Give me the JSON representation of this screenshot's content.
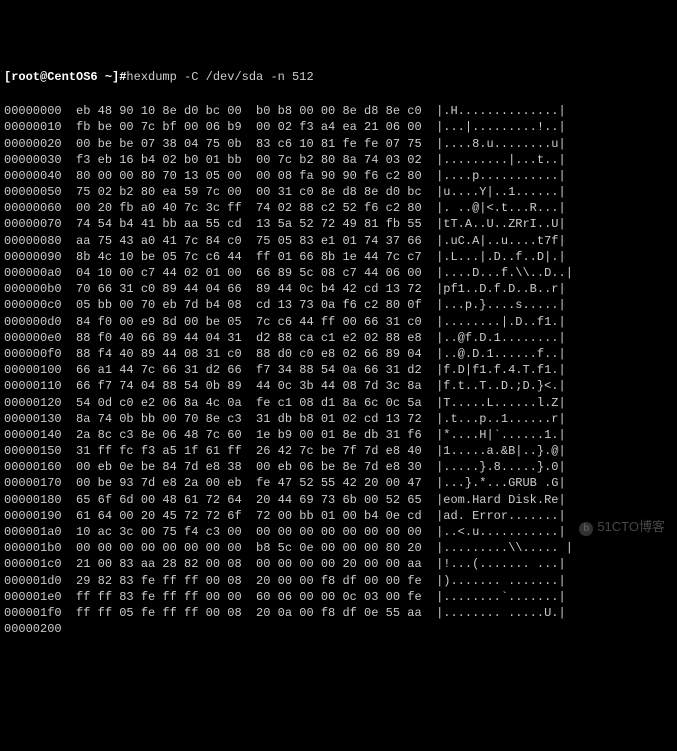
{
  "prompt": {
    "prefix": "[root@CentOS6 ~]#",
    "command": "hexdump -C /dev/sda -n 512"
  },
  "watermark": "51CTO博客",
  "lines": [
    {
      "offset": "00000000",
      "h1": "eb 48 90 10 8e d0 bc 00",
      "h2": "b0 b8 00 00 8e d8 8e c0",
      "ascii": "|.H..............|"
    },
    {
      "offset": "00000010",
      "h1": "fb be 00 7c bf 00 06 b9",
      "h2": "00 02 f3 a4 ea 21 06 00",
      "ascii": "|...|.........!..|"
    },
    {
      "offset": "00000020",
      "h1": "00 be be 07 38 04 75 0b",
      "h2": "83 c6 10 81 fe fe 07 75",
      "ascii": "|....8.u........u|"
    },
    {
      "offset": "00000030",
      "h1": "f3 eb 16 b4 02 b0 01 bb",
      "h2": "00 7c b2 80 8a 74 03 02",
      "ascii": "|.........|...t..|"
    },
    {
      "offset": "00000040",
      "h1": "80 00 00 80 70 13 05 00",
      "h2": "00 08 fa 90 90 f6 c2 80",
      "ascii": "|....p...........|"
    },
    {
      "offset": "00000050",
      "h1": "75 02 b2 80 ea 59 7c 00",
      "h2": "00 31 c0 8e d8 8e d0 bc",
      "ascii": "|u....Y|..1......|"
    },
    {
      "offset": "00000060",
      "h1": "00 20 fb a0 40 7c 3c ff",
      "h2": "74 02 88 c2 52 f6 c2 80",
      "ascii": "|. ..@|<.t...R...|"
    },
    {
      "offset": "00000070",
      "h1": "74 54 b4 41 bb aa 55 cd",
      "h2": "13 5a 52 72 49 81 fb 55",
      "ascii": "|tT.A..U..ZRrI..U|"
    },
    {
      "offset": "00000080",
      "h1": "aa 75 43 a0 41 7c 84 c0",
      "h2": "75 05 83 e1 01 74 37 66",
      "ascii": "|.uC.A|..u....t7f|"
    },
    {
      "offset": "00000090",
      "h1": "8b 4c 10 be 05 7c c6 44",
      "h2": "ff 01 66 8b 1e 44 7c c7",
      "ascii": "|.L...|.D..f..D|.|"
    },
    {
      "offset": "000000a0",
      "h1": "04 10 00 c7 44 02 01 00",
      "h2": "66 89 5c 08 c7 44 06 00",
      "ascii": "|....D...f.\\\\..D..|"
    },
    {
      "offset": "000000b0",
      "h1": "70 66 31 c0 89 44 04 66",
      "h2": "89 44 0c b4 42 cd 13 72",
      "ascii": "|pf1..D.f.D..B..r|"
    },
    {
      "offset": "000000c0",
      "h1": "05 bb 00 70 eb 7d b4 08",
      "h2": "cd 13 73 0a f6 c2 80 0f",
      "ascii": "|...p.}....s.....|"
    },
    {
      "offset": "000000d0",
      "h1": "84 f0 00 e9 8d 00 be 05",
      "h2": "7c c6 44 ff 00 66 31 c0",
      "ascii": "|........|.D..f1.|"
    },
    {
      "offset": "000000e0",
      "h1": "88 f0 40 66 89 44 04 31",
      "h2": "d2 88 ca c1 e2 02 88 e8",
      "ascii": "|..@f.D.1........|"
    },
    {
      "offset": "000000f0",
      "h1": "88 f4 40 89 44 08 31 c0",
      "h2": "88 d0 c0 e8 02 66 89 04",
      "ascii": "|..@.D.1......f..|"
    },
    {
      "offset": "00000100",
      "h1": "66 a1 44 7c 66 31 d2 66",
      "h2": "f7 34 88 54 0a 66 31 d2",
      "ascii": "|f.D|f1.f.4.T.f1.|"
    },
    {
      "offset": "00000110",
      "h1": "66 f7 74 04 88 54 0b 89",
      "h2": "44 0c 3b 44 08 7d 3c 8a",
      "ascii": "|f.t..T..D.;D.}<.|"
    },
    {
      "offset": "00000120",
      "h1": "54 0d c0 e2 06 8a 4c 0a",
      "h2": "fe c1 08 d1 8a 6c 0c 5a",
      "ascii": "|T.....L......l.Z|"
    },
    {
      "offset": "00000130",
      "h1": "8a 74 0b bb 00 70 8e c3",
      "h2": "31 db b8 01 02 cd 13 72",
      "ascii": "|.t...p..1......r|"
    },
    {
      "offset": "00000140",
      "h1": "2a 8c c3 8e 06 48 7c 60",
      "h2": "1e b9 00 01 8e db 31 f6",
      "ascii": "|*....H|`......1.|"
    },
    {
      "offset": "00000150",
      "h1": "31 ff fc f3 a5 1f 61 ff",
      "h2": "26 42 7c be 7f 7d e8 40",
      "ascii": "|1.....a.&B|..}.@|"
    },
    {
      "offset": "00000160",
      "h1": "00 eb 0e be 84 7d e8 38",
      "h2": "00 eb 06 be 8e 7d e8 30",
      "ascii": "|.....}.8.....}.0|"
    },
    {
      "offset": "00000170",
      "h1": "00 be 93 7d e8 2a 00 eb",
      "h2": "fe 47 52 55 42 20 00 47",
      "ascii": "|...}.*...GRUB .G|"
    },
    {
      "offset": "00000180",
      "h1": "65 6f 6d 00 48 61 72 64",
      "h2": "20 44 69 73 6b 00 52 65",
      "ascii": "|eom.Hard Disk.Re|"
    },
    {
      "offset": "00000190",
      "h1": "61 64 00 20 45 72 72 6f",
      "h2": "72 00 bb 01 00 b4 0e cd",
      "ascii": "|ad. Error.......|"
    },
    {
      "offset": "000001a0",
      "h1": "10 ac 3c 00 75 f4 c3 00",
      "h2": "00 00 00 00 00 00 00 00",
      "ascii": "|..<.u...........|"
    },
    {
      "offset": "000001b0",
      "h1": "00 00 00 00 00 00 00 00",
      "h2": "b8 5c 0e 00 00 00 80 20",
      "ascii": "|.........\\\\..... |"
    },
    {
      "offset": "000001c0",
      "h1": "21 00 83 aa 28 82 00 08",
      "h2": "00 00 00 00 20 00 00 aa",
      "ascii": "|!...(....... ...|"
    },
    {
      "offset": "000001d0",
      "h1": "29 82 83 fe ff ff 00 08",
      "h2": "20 00 00 f8 df 00 00 fe",
      "ascii": "|)....... .......|"
    },
    {
      "offset": "000001e0",
      "h1": "ff ff 83 fe ff ff 00 00",
      "h2": "60 06 00 00 0c 03 00 fe",
      "ascii": "|........`.......|"
    },
    {
      "offset": "000001f0",
      "h1": "ff ff 05 fe ff ff 00 08",
      "h2": "20 0a 00 f8 df 0e 55 aa",
      "ascii": "|........ .....U.|"
    },
    {
      "offset": "00000200",
      "h1": "",
      "h2": "",
      "ascii": ""
    }
  ]
}
